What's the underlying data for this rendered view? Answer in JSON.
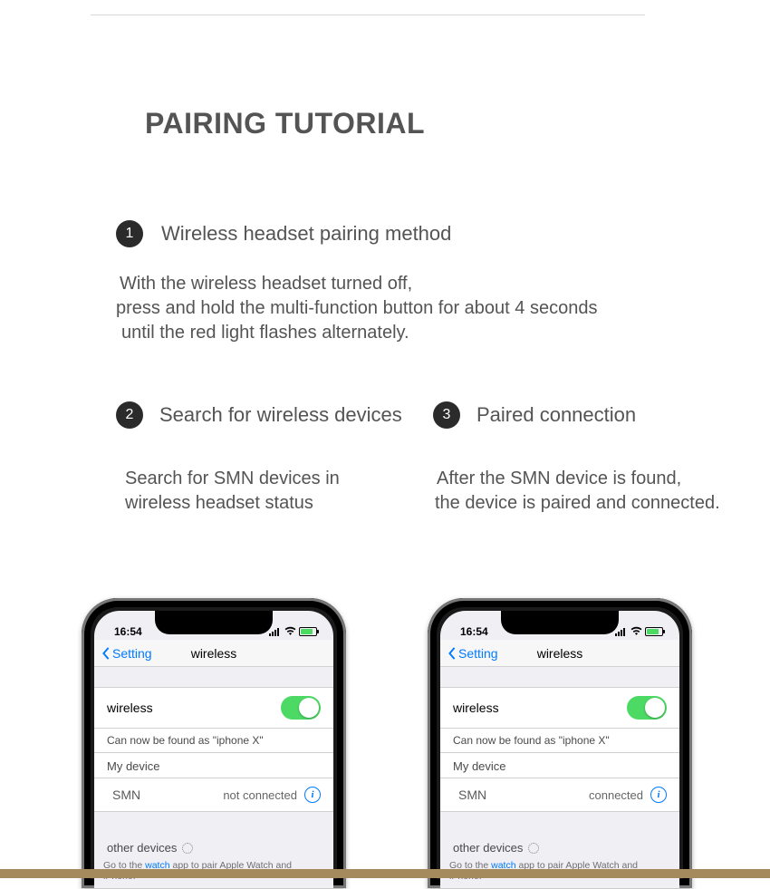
{
  "title": "PAIRING TUTORIAL",
  "steps": {
    "s1": {
      "num": "1",
      "heading": "Wireless headset pairing method",
      "desc_l1": "With the wireless headset turned off,",
      "desc_l2": "press and hold the multi-function button for about 4 seconds",
      "desc_l3": " until the red light flashes alternately."
    },
    "s2": {
      "num": "2",
      "heading": "Search for wireless devices",
      "desc_l1": "Search for SMN devices in",
      "desc_l2": " wireless headset status"
    },
    "s3": {
      "num": "3",
      "heading": "Paired connection",
      "desc_l1": "After the SMN device is found,",
      "desc_l2": "the device is paired and connected."
    }
  },
  "phone": {
    "time": "16:54",
    "nav_back": "Setting",
    "nav_title": "wireless",
    "wireless_label": "wireless",
    "discoverable": "Can now be found as \"iphone X\"",
    "my_device_header": "My device",
    "device_name": "SMN",
    "other_devices": "other devices",
    "footnote_pre": "Go to the ",
    "footnote_link": "watch",
    "footnote_post": " app to pair Apple Watch and iPhone.",
    "info_i": "i"
  },
  "status": {
    "not_connected": "not connected",
    "connected": "connected"
  }
}
